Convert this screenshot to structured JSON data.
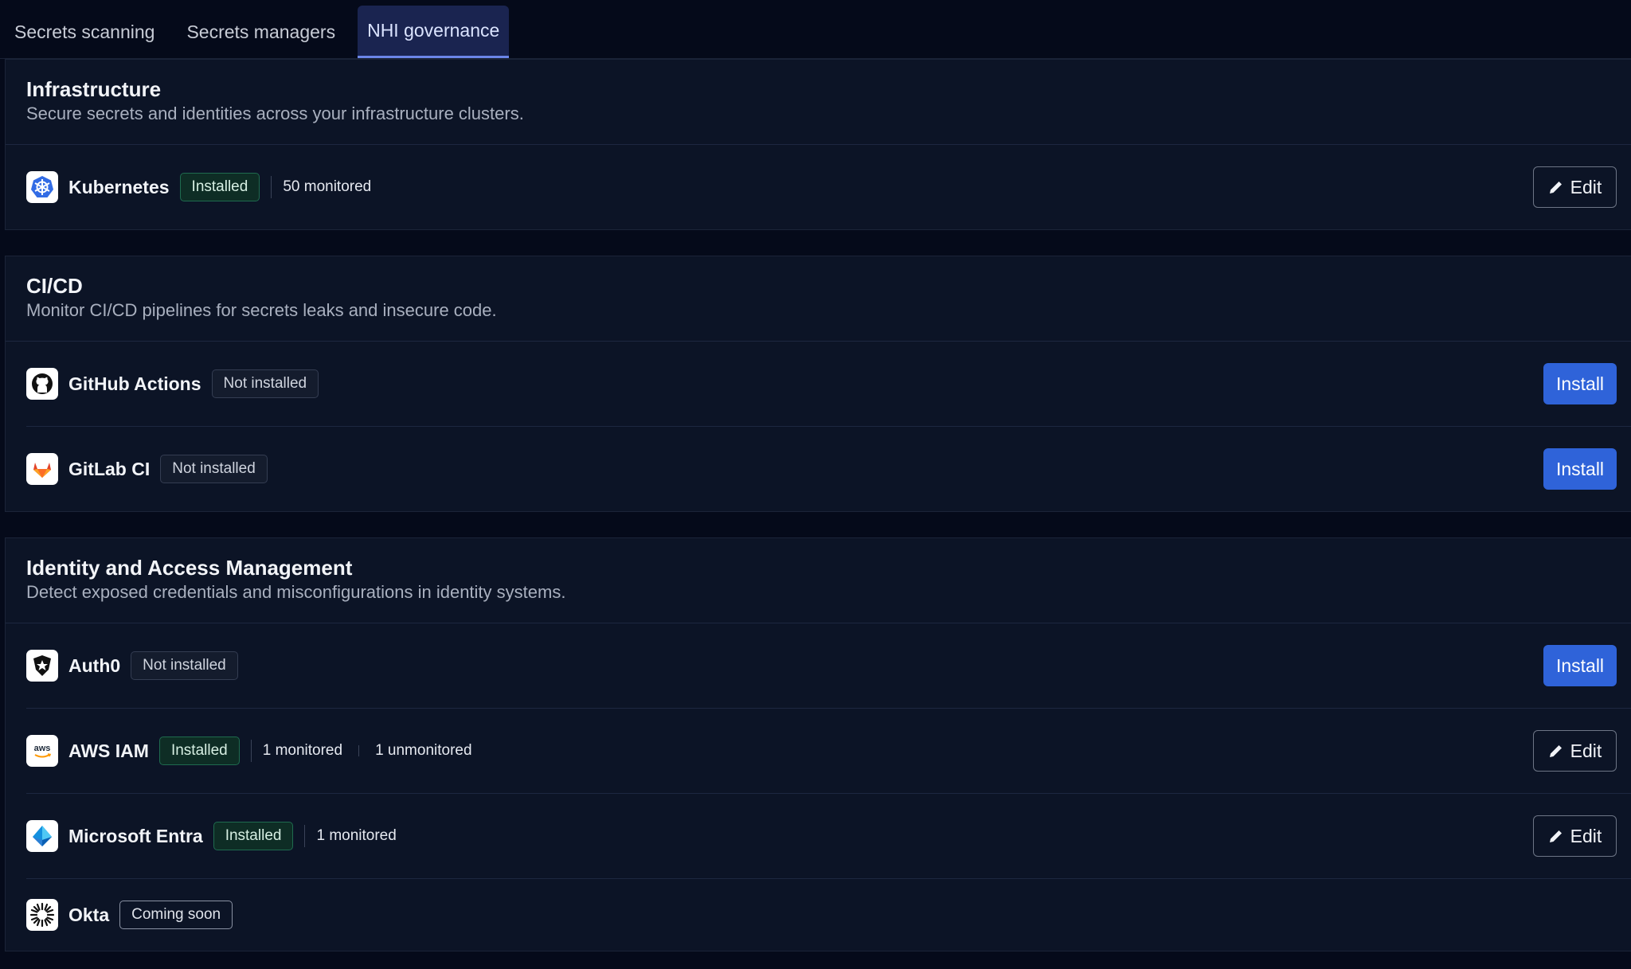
{
  "tabs": [
    {
      "label": "Secrets scanning",
      "active": false
    },
    {
      "label": "Secrets managers",
      "active": false
    },
    {
      "label": "NHI governance",
      "active": true
    }
  ],
  "colors": {
    "background": "#050a1a",
    "panel": "#0c1426",
    "accent": "#2f63d9",
    "installed_bg": "#0e2d25",
    "installed_border": "#1f6b4f"
  },
  "sections": [
    {
      "title": "Infrastructure",
      "description": "Secure secrets and identities across your infrastructure clusters.",
      "items": [
        {
          "name": "Kubernetes",
          "icon": "kubernetes-icon",
          "status": "Installed",
          "stats": [
            "50 monitored"
          ],
          "action": "Edit"
        }
      ]
    },
    {
      "title": "CI/CD",
      "description": "Monitor CI/CD pipelines for secrets leaks and insecure code.",
      "items": [
        {
          "name": "GitHub Actions",
          "icon": "github-icon",
          "status": "Not installed",
          "stats": [],
          "action": "Install"
        },
        {
          "name": "GitLab CI",
          "icon": "gitlab-icon",
          "status": "Not installed",
          "stats": [],
          "action": "Install"
        }
      ]
    },
    {
      "title": "Identity and Access Management",
      "description": "Detect exposed credentials and misconfigurations in identity systems.",
      "items": [
        {
          "name": "Auth0",
          "icon": "auth0-icon",
          "status": "Not installed",
          "stats": [],
          "action": "Install"
        },
        {
          "name": "AWS IAM",
          "icon": "aws-icon",
          "status": "Installed",
          "stats": [
            "1 monitored",
            "1 unmonitored"
          ],
          "action": "Edit"
        },
        {
          "name": "Microsoft Entra",
          "icon": "microsoft-entra-icon",
          "status": "Installed",
          "stats": [
            "1 monitored"
          ],
          "action": "Edit"
        },
        {
          "name": "Okta",
          "icon": "okta-icon",
          "status": "Coming soon",
          "stats": [],
          "action": ""
        }
      ]
    }
  ],
  "logo_text": {
    "aws": "aws"
  }
}
